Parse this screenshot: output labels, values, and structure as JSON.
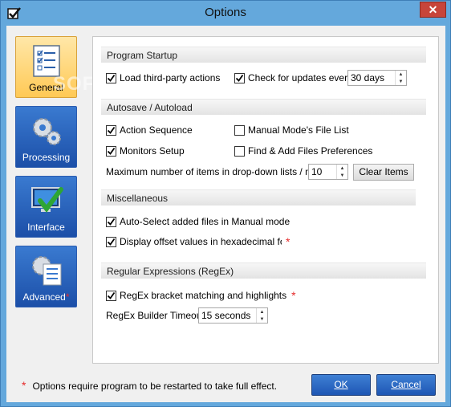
{
  "window": {
    "title": "Options",
    "close_glyph": "✕"
  },
  "nav": {
    "items": [
      {
        "label": "General",
        "icon": "checklist-icon",
        "active": true
      },
      {
        "label": "Processing",
        "icon": "gears-icon",
        "active": false
      },
      {
        "label": "Interface",
        "icon": "monitor-check-icon",
        "active": false
      },
      {
        "label": "Advanced",
        "icon": "gear-list-icon",
        "active": false,
        "required": "*"
      }
    ]
  },
  "sections": {
    "startup": {
      "title": "Program Startup",
      "load_third_party": {
        "label": "Load third-party actions",
        "checked": true
      },
      "check_updates": {
        "label": "Check for updates every",
        "checked": true
      },
      "update_interval": "30 days"
    },
    "autosave": {
      "title": "Autosave / Autoload",
      "action_sequence": {
        "label": "Action Sequence",
        "checked": true
      },
      "manual_mode_list": {
        "label": "Manual Mode's File List",
        "checked": false
      },
      "monitors_setup": {
        "label": "Monitors Setup",
        "checked": true
      },
      "find_add_prefs": {
        "label": "Find & Add Files Preferences",
        "checked": false
      },
      "max_items_label": "Maximum number of items in drop-down lists / menus:",
      "max_items_value": "10",
      "clear_items": "Clear Items"
    },
    "misc": {
      "title": "Miscellaneous",
      "auto_select": {
        "label": "Auto-Select added files in Manual mode",
        "checked": true
      },
      "display_offset": {
        "label": "Display offset values in hexadecimal format",
        "checked": true,
        "required": "*"
      }
    },
    "regex": {
      "title": "Regular Expressions (RegEx)",
      "bracket_matching": {
        "label": "RegEx bracket matching and highlights",
        "checked": true,
        "required": "*"
      },
      "timeout_label": "RegEx Builder Timeout:",
      "timeout_value": "15 seconds"
    }
  },
  "footer": {
    "note_star": "*",
    "note": "Options require program to be restarted to take full effect.",
    "ok": "OK",
    "cancel": "Cancel"
  },
  "watermark": "SOFTPEDIA",
  "colors": {
    "titlebar": "#64a8dc",
    "nav_active": "#ffc955",
    "nav_inactive": "#1c4fa8",
    "required_star": "#e52b2b"
  }
}
